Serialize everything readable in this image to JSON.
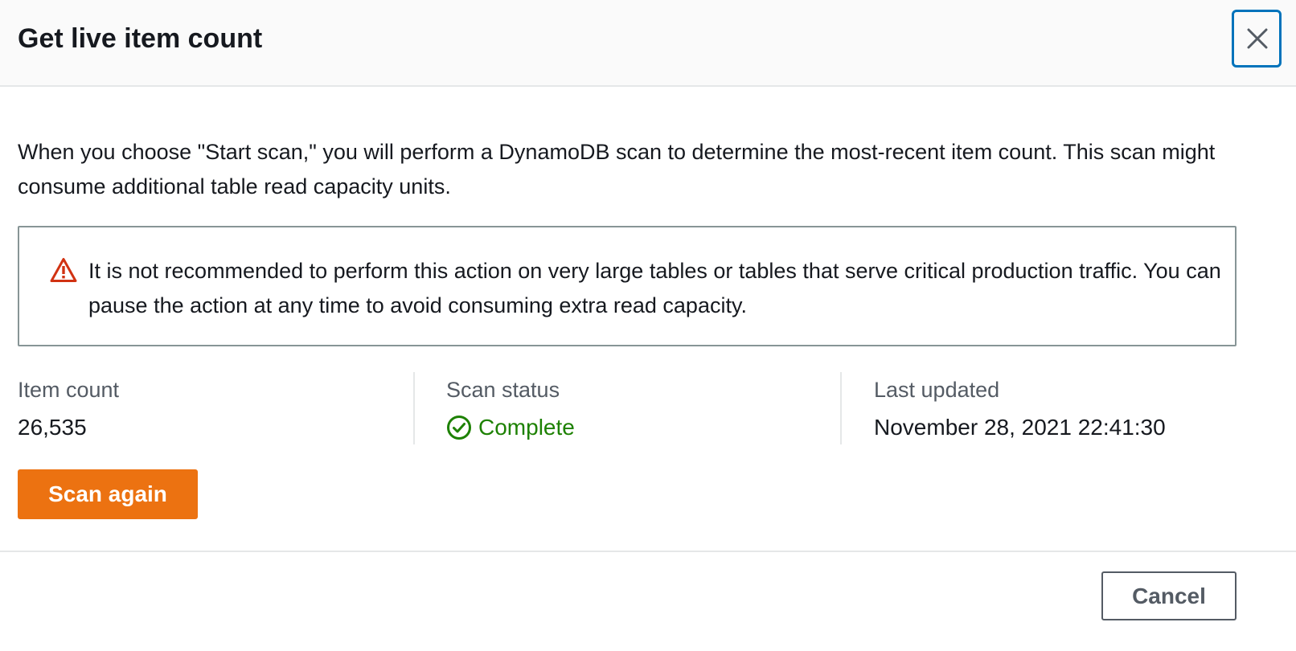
{
  "header": {
    "title": "Get live item count",
    "close_icon": "close-icon"
  },
  "description": "When you choose \"Start scan,\" you will perform a DynamoDB scan to determine the most-recent item count. This scan might consume additional table read capacity units.",
  "alert": {
    "icon": "warning-icon",
    "text": "It is not recommended to perform this action on very large tables or tables that serve critical production traffic. You can pause the action at any time to avoid consuming extra read capacity."
  },
  "stats": {
    "item_count": {
      "label": "Item count",
      "value": "26,535"
    },
    "scan_status": {
      "label": "Scan status",
      "value": "Complete",
      "icon": "check-circle-icon"
    },
    "last_updated": {
      "label": "Last updated",
      "value": "November 28, 2021 22:41:30"
    }
  },
  "actions": {
    "scan_again_label": "Scan again",
    "cancel_label": "Cancel"
  },
  "colors": {
    "primary_button": "#ec7211",
    "success": "#1d8102",
    "warning": "#d13212",
    "focus_ring": "#0073bb",
    "text": "#16191f",
    "secondary_text": "#545b64"
  }
}
